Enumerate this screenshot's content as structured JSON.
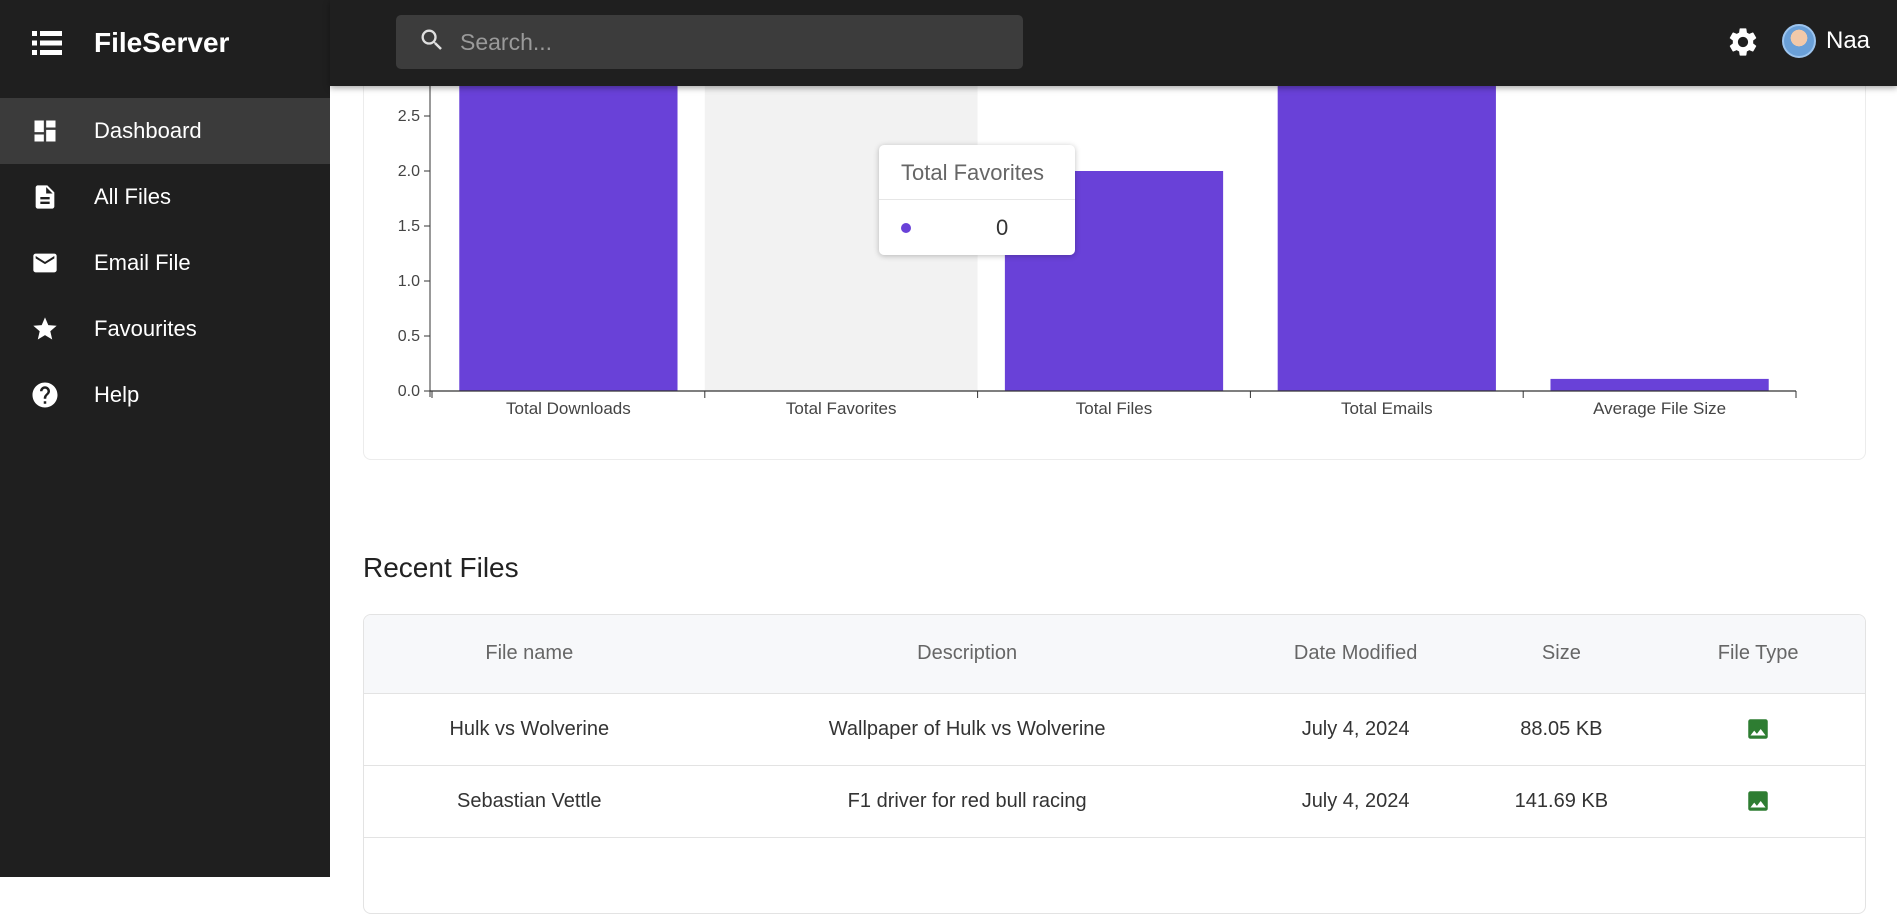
{
  "app": {
    "title": "FileServer"
  },
  "sidebar": {
    "items": [
      {
        "label": "Dashboard",
        "icon": "dashboard-icon",
        "active": true
      },
      {
        "label": "All Files",
        "icon": "file-icon",
        "active": false
      },
      {
        "label": "Email File",
        "icon": "mail-icon",
        "active": false
      },
      {
        "label": "Favourites",
        "icon": "star-icon",
        "active": false
      },
      {
        "label": "Help",
        "icon": "help-icon",
        "active": false
      }
    ]
  },
  "topbar": {
    "search_placeholder": "Search...",
    "user_name": "Naa"
  },
  "colors": {
    "bar": "#6941d8",
    "sidebar_bg": "#1f1f1f",
    "active_bg": "#3b3b3b",
    "file_type_icon": "#2e7d32"
  },
  "chart_data": {
    "type": "bar",
    "categories": [
      "Total Downloads",
      "Total Favorites",
      "Total Files",
      "Total Emails",
      "Average File Size"
    ],
    "values": [
      3,
      0,
      2,
      3,
      0.11
    ],
    "y_ticks": [
      "0.0",
      "0.5",
      "1.0",
      "1.5",
      "2.0",
      "2.5"
    ],
    "visible_ylim": [
      0,
      2.8
    ],
    "highlighted_category": "Total Favorites",
    "tooltip": {
      "title": "Total Favorites",
      "value": "0"
    }
  },
  "recent_files": {
    "title": "Recent Files",
    "columns": [
      "File name",
      "Description",
      "Date Modified",
      "Size",
      "File Type"
    ],
    "rows": [
      {
        "name": "Hulk vs Wolverine",
        "description": "Wallpaper of Hulk vs Wolverine",
        "date": "July 4, 2024",
        "size": "88.05 KB",
        "type": "image-icon"
      },
      {
        "name": "Sebastian Vettle",
        "description": "F1 driver for red bull racing",
        "date": "July 4, 2024",
        "size": "141.69 KB",
        "type": "image-icon"
      }
    ]
  }
}
